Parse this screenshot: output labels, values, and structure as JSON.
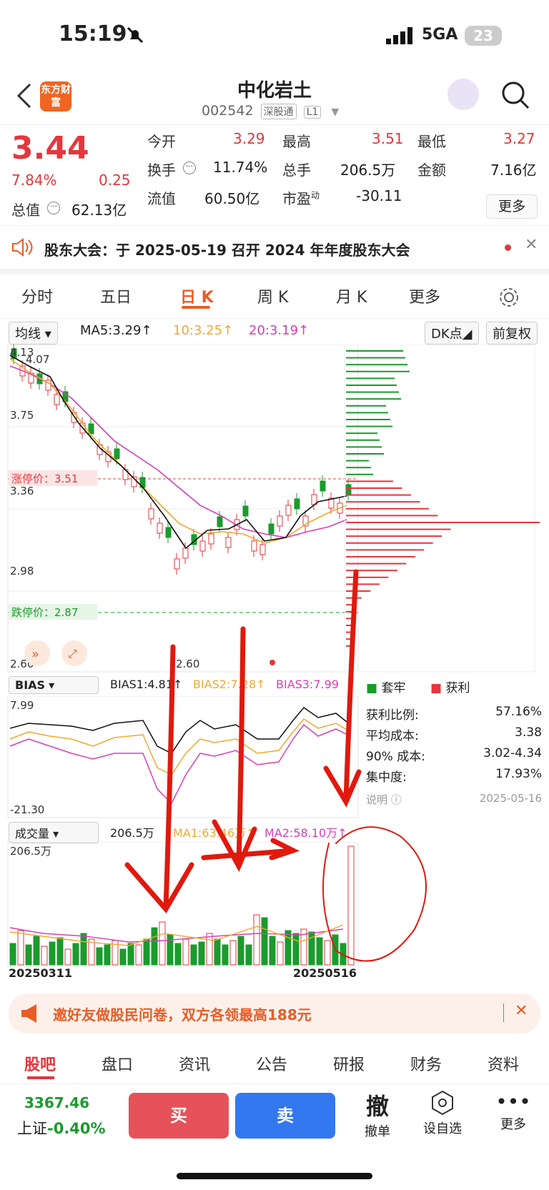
{
  "status_bar": {
    "time": "15:19",
    "network": "5GA",
    "battery": "23"
  },
  "header": {
    "logo": "东方财富",
    "name": "中化岩土",
    "code": "002542",
    "tag1": "深股通",
    "tag2": "L1"
  },
  "quote": {
    "price": "3.44",
    "change_pct": "7.84%",
    "change": "0.25",
    "open_label": "今开",
    "open": "3.29",
    "high_label": "最高",
    "high": "3.51",
    "low_label": "最低",
    "low": "3.27",
    "turnover_label": "换手",
    "turnover": "11.74%",
    "volume_label": "总手",
    "volume": "206.5万",
    "amount_label": "金额",
    "amount": "7.16亿",
    "mcap_label": "总值",
    "mcap": "62.13亿",
    "float_label": "流值",
    "float": "60.50亿",
    "pe_label": "市盈",
    "pe_sup": "动",
    "pe": "-30.11",
    "more": "更多"
  },
  "notice": {
    "text": "股东大会：于 2025-05-19 召开 2024 年年度股东大会"
  },
  "tabs": [
    "分时",
    "五日",
    "日 K",
    "周 K",
    "月 K",
    "更多"
  ],
  "chart_bar": {
    "indicator": "均线",
    "ma5": "MA5:3.29↑",
    "ma10": "10:3.25↑",
    "ma20": "20:3.19↑",
    "dk": "DK点",
    "adjust": "前复权"
  },
  "colors": {
    "red": "#e5363d",
    "green": "#1a9b2c",
    "ma5": "#111111",
    "ma10": "#f0a830",
    "ma20": "#d63fb8",
    "accent": "#e85d27"
  },
  "kline_labels": {
    "top": "4.13",
    "top_marker": "4.07",
    "y1": "3.75",
    "y2": "3.36",
    "y3": "2.98",
    "y4": "2.60",
    "low_marker": "2.60",
    "limit_up": "涨停价：3.51",
    "limit_down": "跌停价：2.87"
  },
  "chip": {
    "legend_trap": "套牢",
    "legend_profit": "获利",
    "rows": [
      {
        "label": "获利比例:",
        "value": "57.16%"
      },
      {
        "label": "平均成本:",
        "value": "3.38"
      },
      {
        "label": "90% 成本:",
        "value": "3.02-4.34"
      },
      {
        "label": "集中度:",
        "value": "17.93%"
      }
    ],
    "note": "说明",
    "date": "2025-05-16"
  },
  "bias": {
    "name": "BIAS",
    "b1": "BIAS1:4.81↑",
    "b2": "BIAS2:7.28↑",
    "b3": "BIAS3:7.99",
    "top": "7.99",
    "bottom": "-21.30"
  },
  "vol": {
    "name": "成交量",
    "v": "206.5万",
    "ma1": "MA1:63.46万↑",
    "ma2": "MA2:58.10万↑",
    "top": "206.5万",
    "date_start": "20250311",
    "date_end": "20250516"
  },
  "promo": {
    "text": "邀好友做股民问卷，双方各领最高188元"
  },
  "bottom_tabs": [
    "股吧",
    "盘口",
    "资讯",
    "公告",
    "研报",
    "财务",
    "资料"
  ],
  "footer": {
    "index_value": "3367.46",
    "index_name": "上证",
    "index_change": "-0.40%",
    "buy": "买",
    "sell": "卖",
    "cancel_icon": "撤",
    "cancel": "撤单",
    "watch": "设自选",
    "more": "更多"
  }
}
